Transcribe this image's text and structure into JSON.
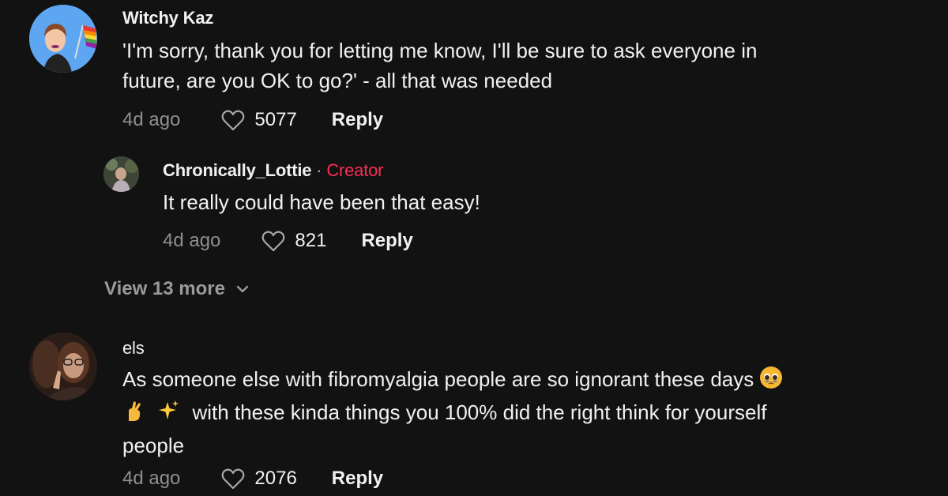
{
  "comments": [
    {
      "username": "Witchy Kaz",
      "text_lines": [
        "'I'm sorry, thank you for letting me know, I'll be sure to ask everyone in",
        "future, are you OK to go?' - all that was needed"
      ],
      "time": "4d ago",
      "likes": "5077",
      "reply_label": "Reply",
      "avatar_icon": "memoji-with-pride-flag"
    },
    {
      "username": "Chronically_Lottie",
      "separator": "·",
      "badge": "Creator",
      "text_lines": [
        "It really could have been that easy!"
      ],
      "time": "4d ago",
      "likes": "821",
      "reply_label": "Reply",
      "avatar_icon": "user-photo"
    },
    {
      "username": "els",
      "text_lines": [
        "As someone else with fibromyalgia people are so ignorant these days",
        "with these kinda things you 100% did the right think for yourself",
        "people"
      ],
      "emojis": [
        "pleading-face",
        "crossed-fingers",
        "sparkles"
      ],
      "time": "4d ago",
      "likes": "2076",
      "reply_label": "Reply",
      "avatar_icon": "user-photo"
    }
  ],
  "view_more": {
    "label": "View 13 more",
    "icon": "chevron-down-icon"
  },
  "colors": {
    "background": "#121212",
    "creator": "#fe2c55",
    "muted": "#8f8f8f"
  }
}
